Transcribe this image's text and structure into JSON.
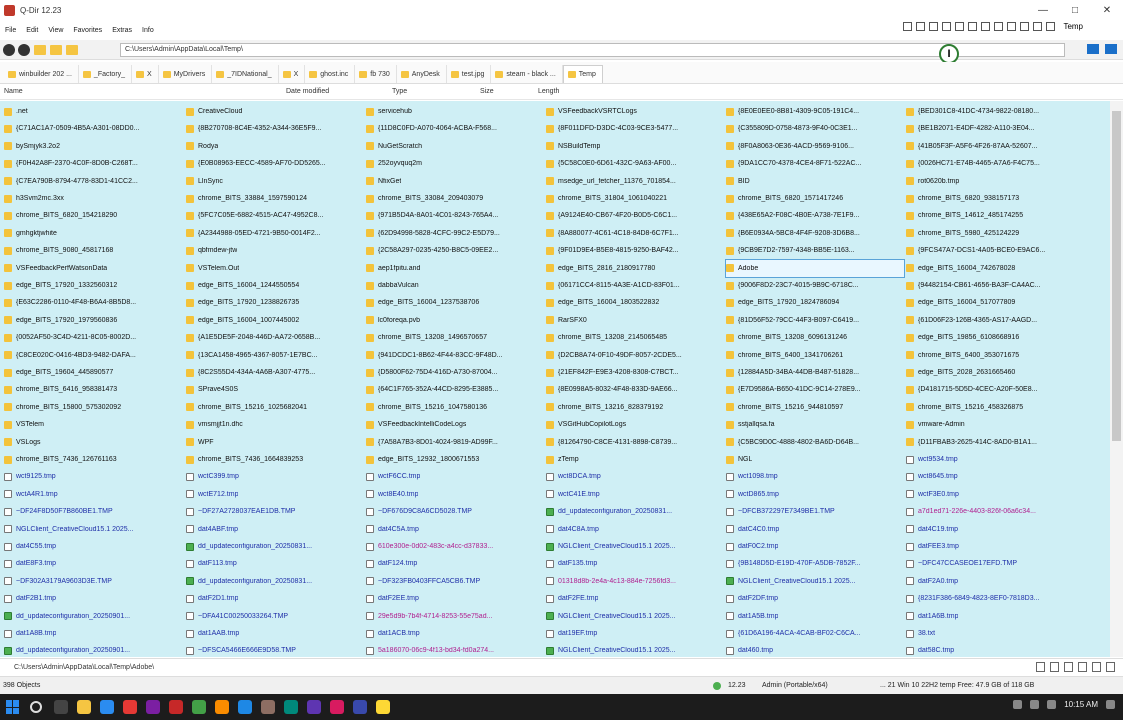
{
  "window": {
    "title": "Q-Dir 12.23",
    "controls": [
      "—",
      "□",
      "✕"
    ]
  },
  "menu": {
    "items": [
      "File",
      "Edit",
      "View",
      "Favorites",
      "Extras",
      "Info"
    ],
    "folder_label": "Temp"
  },
  "address": {
    "path": "C:\\Users\\Admin\\AppData\\Local\\Temp\\"
  },
  "tabs": [
    {
      "label": "winbuilder 202 ..."
    },
    {
      "label": "_Factory_"
    },
    {
      "label": "X"
    },
    {
      "label": "MyDrivers"
    },
    {
      "label": "_7IDNational_"
    },
    {
      "label": "X"
    },
    {
      "label": "ghost.inc"
    },
    {
      "label": "fb 730"
    },
    {
      "label": "AnyDesk"
    },
    {
      "label": "test.jpg"
    },
    {
      "label": "steam - black ..."
    },
    {
      "label": "Temp",
      "active": true
    }
  ],
  "columns": {
    "name": "Name",
    "date_modified": "Date modified",
    "type": "Type",
    "size": "Size",
    "length": "Length"
  },
  "files": [
    [
      {
        "n": ".net",
        "t": "folder"
      },
      {
        "n": "{C71AC1A7-0509-4B5A-A301-08DD0...",
        "t": "folder"
      },
      {
        "n": "bySmjyk3.2o2",
        "t": "folder"
      },
      {
        "n": "{F0H42A8F-2370-4C0F-8D0B-C268T...",
        "t": "folder"
      },
      {
        "n": "{C7EA790B-8794-4778-83D1-41CC2...",
        "t": "folder"
      },
      {
        "n": "h3Svm2mc.3xx",
        "t": "folder"
      },
      {
        "n": "chrome_BITS_6820_154218290",
        "t": "folder"
      },
      {
        "n": "gmhgktjwhite",
        "t": "folder"
      },
      {
        "n": "chrome_BITS_9080_45817168",
        "t": "folder"
      },
      {
        "n": "VSFeedbackPerfWatsonData",
        "t": "folder"
      },
      {
        "n": "edge_BITS_17920_1332560312",
        "t": "folder"
      },
      {
        "n": "{E63C2286-0110-4F48-B6A4-8B5D8...",
        "t": "folder"
      },
      {
        "n": "edge_BITS_17920_1979560836",
        "t": "folder"
      },
      {
        "n": "{0052AF50-3C4D-4211-8C05-8002D...",
        "t": "folder"
      },
      {
        "n": "{C8CE020C-0416-4BD3-9482-DAFA...",
        "t": "folder"
      },
      {
        "n": "edge_BITS_19604_445890577",
        "t": "folder"
      },
      {
        "n": "chrome_BITS_6416_958381473",
        "t": "folder"
      },
      {
        "n": "chrome_BITS_15800_575302092",
        "t": "folder"
      },
      {
        "n": "VSTelem",
        "t": "folder"
      },
      {
        "n": "VSLogs",
        "t": "folder"
      },
      {
        "n": "chrome_BITS_7436_126761163",
        "t": "folder"
      },
      {
        "n": "wct9125.tmp",
        "t": "file"
      },
      {
        "n": "wctA4R1.tmp",
        "t": "file"
      },
      {
        "n": "~DF24F8D50F7B860BE1.TMP",
        "t": "file"
      },
      {
        "n": "NGLClient_CreativeCloud15.1 2025...",
        "t": "file"
      },
      {
        "n": "dat4C55.tmp",
        "t": "file"
      },
      {
        "n": "datE8F3.tmp",
        "t": "file"
      },
      {
        "n": "~DF302A3179A9603D3E.TMP",
        "t": "file"
      },
      {
        "n": "datF2B1.tmp",
        "t": "file"
      },
      {
        "n": "dd_updateconfiguration_20250901...",
        "t": "green"
      },
      {
        "n": "dat1A8B.tmp",
        "t": "file"
      },
      {
        "n": "dd_updateconfiguration_20250901...",
        "t": "green"
      }
    ],
    [
      {
        "n": "CreativeCloud",
        "t": "folder"
      },
      {
        "n": "{8B270708-8C4E-4352-A344-36E5F9...",
        "t": "folder"
      },
      {
        "n": "Rodya",
        "t": "folder"
      },
      {
        "n": "{E0B08963-EECC-4589-AF70-DD5265...",
        "t": "folder"
      },
      {
        "n": "LlnSync",
        "t": "folder"
      },
      {
        "n": "chrome_BITS_33884_1597590124",
        "t": "folder"
      },
      {
        "n": "{5FC7C05E-6882-4515-AC47-4952C8...",
        "t": "folder"
      },
      {
        "n": "{A2344988-05ED-4721-9B50-0014F2...",
        "t": "folder"
      },
      {
        "n": "qbfmdew-jtw",
        "t": "folder"
      },
      {
        "n": "VSTelem.Out",
        "t": "folder"
      },
      {
        "n": "edge_BITS_16004_1244550554",
        "t": "folder"
      },
      {
        "n": "edge_BITS_17920_1238826735",
        "t": "folder"
      },
      {
        "n": "edge_BITS_16004_1007445002",
        "t": "folder"
      },
      {
        "n": "{A1E5DE5F-2048-446D-AA72-0658B...",
        "t": "folder"
      },
      {
        "n": "{13CA1458-4965-4367-8057-1E7BC...",
        "t": "folder"
      },
      {
        "n": "{8C2S55D4-434A-4A6B-A307-4775...",
        "t": "folder"
      },
      {
        "n": "SPrave4S0S",
        "t": "folder"
      },
      {
        "n": "chrome_BITS_15216_1025682041",
        "t": "folder"
      },
      {
        "n": "vmsmjjt1n.dhc",
        "t": "folder"
      },
      {
        "n": "WPF",
        "t": "folder"
      },
      {
        "n": "chrome_BITS_7436_1664839253",
        "t": "folder"
      },
      {
        "n": "wctC399.tmp",
        "t": "file"
      },
      {
        "n": "wctE712.tmp",
        "t": "file"
      },
      {
        "n": "~DF27A2728037EAE1DB.TMP",
        "t": "file"
      },
      {
        "n": "dat4ABF.tmp",
        "t": "file"
      },
      {
        "n": "dd_updateconfiguration_20250831...",
        "t": "green"
      },
      {
        "n": "datF113.tmp",
        "t": "file"
      },
      {
        "n": "dd_updateconfiguration_20250831...",
        "t": "green"
      },
      {
        "n": "datF2D1.tmp",
        "t": "file"
      },
      {
        "n": "~DFA41C00250033264.TMP",
        "t": "file"
      },
      {
        "n": "dat1AAB.tmp",
        "t": "file"
      },
      {
        "n": "~DFSCA5466E666E9D58.TMP",
        "t": "file"
      }
    ],
    [
      {
        "n": "servicehub",
        "t": "folder"
      },
      {
        "n": "{11D8C0FD-A070-4064-ACBA-F568...",
        "t": "folder"
      },
      {
        "n": "NuGetScratch",
        "t": "folder"
      },
      {
        "n": "252oyvquq2m",
        "t": "folder"
      },
      {
        "n": "NfixGet",
        "t": "folder"
      },
      {
        "n": "chrome_BITS_33084_209403079",
        "t": "folder"
      },
      {
        "n": "{971B5D4A-8A01-4C01-8243-765A4...",
        "t": "folder"
      },
      {
        "n": "{62D94998-5828-4CFC-99C2-E5D79...",
        "t": "folder"
      },
      {
        "n": "{2C58A297-0235-4250-B8C5-09EE2...",
        "t": "folder"
      },
      {
        "n": "aep1fpitu.and",
        "t": "folder"
      },
      {
        "n": "dabbaVulcan",
        "t": "folder"
      },
      {
        "n": "edge_BITS_16004_1237538706",
        "t": "folder"
      },
      {
        "n": "lc0foreqa.pvb",
        "t": "folder"
      },
      {
        "n": "chrome_BITS_13208_1496570657",
        "t": "folder"
      },
      {
        "n": "{941DCDC1-8B62-4F44-83CC-9F48D...",
        "t": "folder"
      },
      {
        "n": "{D5800F62-75D4-416D-A730-87004...",
        "t": "folder"
      },
      {
        "n": "{64C1F765-352A-44CD-8295-E3885...",
        "t": "folder"
      },
      {
        "n": "chrome_BITS_15216_1047580136",
        "t": "folder"
      },
      {
        "n": "VSFeedbackIntelliCodeLogs",
        "t": "folder"
      },
      {
        "n": "{7A58A7B3-8D01-4024-9819-AD99F...",
        "t": "folder"
      },
      {
        "n": "edge_BITS_12932_1800671553",
        "t": "folder"
      },
      {
        "n": "wctF6CC.tmp",
        "t": "file"
      },
      {
        "n": "wct8E40.tmp",
        "t": "file"
      },
      {
        "n": "~DF676D9C8A6CD5028.TMP",
        "t": "file"
      },
      {
        "n": "dat4C5A.tmp",
        "t": "file"
      },
      {
        "n": "610e300e-0d02-483c-a4cc-d37833...",
        "t": "pink"
      },
      {
        "n": "datF124.tmp",
        "t": "file"
      },
      {
        "n": "~DF323FB0403FFCA5CB6.TMP",
        "t": "file"
      },
      {
        "n": "datF2EE.tmp",
        "t": "file"
      },
      {
        "n": "29e5d9b-7b4f-4714-8253-55e75ad...",
        "t": "pink"
      },
      {
        "n": "dat1ACB.tmp",
        "t": "file"
      },
      {
        "n": "5a186070-06c9-4f13-bd34-fd0a274...",
        "t": "pink"
      }
    ],
    [
      {
        "n": "VSFeedbackVSRTCLogs",
        "t": "folder"
      },
      {
        "n": "{8F011DFD-D3DC-4C03-9CE3-5477...",
        "t": "folder"
      },
      {
        "n": "NSBuildTemp",
        "t": "folder"
      },
      {
        "n": "{5C58C0E0-6D61-432C-9A63-AF00...",
        "t": "folder"
      },
      {
        "n": "msedge_url_fetcher_11376_701854...",
        "t": "folder"
      },
      {
        "n": "chrome_BITS_31804_1061040221",
        "t": "folder"
      },
      {
        "n": "{A9124E40-CB67-4F20-B0D5-C6C1...",
        "t": "folder"
      },
      {
        "n": "{8A880077-4C61-4C18-84D8-6C7F1...",
        "t": "folder"
      },
      {
        "n": "{9F01D9E4-B5E8-4815-9250-BAF42...",
        "t": "folder"
      },
      {
        "n": "edge_BITS_2816_2180917780",
        "t": "folder"
      },
      {
        "n": "{06171CC4-8115-4A3E-A1CD-83F01...",
        "t": "folder"
      },
      {
        "n": "edge_BITS_16004_1803522832",
        "t": "folder"
      },
      {
        "n": "RarSFX0",
        "t": "folder"
      },
      {
        "n": "chrome_BITS_13208_2145065485",
        "t": "folder"
      },
      {
        "n": "{D2CB8A74-0F10-49DF-8057-2CDE5...",
        "t": "folder"
      },
      {
        "n": "{21EF842F-E9E3-4208-8308-C7BCT...",
        "t": "folder"
      },
      {
        "n": "{8E0998A5-8032-4F48-833D-9AE66...",
        "t": "folder"
      },
      {
        "n": "chrome_BITS_13216_828379192",
        "t": "folder"
      },
      {
        "n": "VSGitHubCopilotLogs",
        "t": "folder"
      },
      {
        "n": "{81264790-C8CE-4131-8898-C8739...",
        "t": "folder"
      },
      {
        "n": "zTemp",
        "t": "folder"
      },
      {
        "n": "wct8DCA.tmp",
        "t": "file"
      },
      {
        "n": "wctC41E.tmp",
        "t": "file"
      },
      {
        "n": "dd_updateconfiguration_20250831...",
        "t": "green"
      },
      {
        "n": "dat4C8A.tmp",
        "t": "file"
      },
      {
        "n": "NGLClient_CreativeCloud15.1 2025...",
        "t": "green"
      },
      {
        "n": "datF135.tmp",
        "t": "file"
      },
      {
        "n": "01318d8b-2e4a-4c13-884e-7256fd3...",
        "t": "pink"
      },
      {
        "n": "datF2FE.tmp",
        "t": "file"
      },
      {
        "n": "NGLClient_CreativeCloud15.1 2025...",
        "t": "green"
      },
      {
        "n": "dat19EF.tmp",
        "t": "file"
      },
      {
        "n": "NGLClient_CreativeCloud15.1 2025...",
        "t": "green"
      }
    ],
    [
      {
        "n": "{8E0E0EE0-8B81-4309-9C05-191C4...",
        "t": "folder"
      },
      {
        "n": "{C355809D-0758-4873-9F40-0C3E1...",
        "t": "folder"
      },
      {
        "n": "{8F0A8063-0E36-4ACD-9569-9106...",
        "t": "folder"
      },
      {
        "n": "{9DA1CC70-4378-4CE4-8F71-522AC...",
        "t": "folder"
      },
      {
        "n": "BID",
        "t": "folder"
      },
      {
        "n": "chrome_BITS_6820_1571417246",
        "t": "folder"
      },
      {
        "n": "{438E65A2-F08C-4B0E-A738-7E1F9...",
        "t": "folder"
      },
      {
        "n": "{B6E0934A-5BC8-4F4F-9208-3D6B8...",
        "t": "folder"
      },
      {
        "n": "{9CB9E7D2-7597-4348-BB5E-1163...",
        "t": "folder"
      },
      {
        "n": "Adobe",
        "t": "folder",
        "selected": true
      },
      {
        "n": "{9006F8D2-23C7-4015-9B9C-6718C...",
        "t": "folder"
      },
      {
        "n": "edge_BITS_17920_1824786094",
        "t": "folder"
      },
      {
        "n": "{81D56F52-79CC-44F3-B097-C6419...",
        "t": "folder"
      },
      {
        "n": "chrome_BITS_13208_6096131246",
        "t": "folder"
      },
      {
        "n": "chrome_BITS_6400_1341706261",
        "t": "folder"
      },
      {
        "n": "{12884A5D-34BA-44DB-B487-51828...",
        "t": "folder"
      },
      {
        "n": "{E7D9586A-B650-41DC-9C14-278E9...",
        "t": "folder"
      },
      {
        "n": "chrome_BITS_15216_944810597",
        "t": "folder"
      },
      {
        "n": "sstjallqsa.fa",
        "t": "folder"
      },
      {
        "n": "{C5BC9D0C-4888-4802-BA6D-D64B...",
        "t": "folder"
      },
      {
        "n": "NGL",
        "t": "folder"
      },
      {
        "n": "wct1098.tmp",
        "t": "file"
      },
      {
        "n": "wctD865.tmp",
        "t": "file"
      },
      {
        "n": "~DFCB372297E7349BE1.TMP",
        "t": "file"
      },
      {
        "n": "datC4C0.tmp",
        "t": "file"
      },
      {
        "n": "datF0C2.tmp",
        "t": "file"
      },
      {
        "n": "{9B148D5D-E19D-470F-A5DB-7852F...",
        "t": "file"
      },
      {
        "n": "NGLClient_CreativeCloud15.1 2025...",
        "t": "green"
      },
      {
        "n": "datF2DF.tmp",
        "t": "file"
      },
      {
        "n": "dat1A5B.tmp",
        "t": "file"
      },
      {
        "n": "{61D6A196-4ACA-4CAB-BF02-C6CA...",
        "t": "file"
      },
      {
        "n": "dat460.tmp",
        "t": "file"
      }
    ],
    [
      {
        "n": "{BED301C8-41DC-4734-9822-08180...",
        "t": "folder"
      },
      {
        "n": "{BE1B2071-E4DF-4282-A110-3E04...",
        "t": "folder"
      },
      {
        "n": "{41B05F3F-A5F6-4F26-87AA-52607...",
        "t": "folder"
      },
      {
        "n": "{0026HC71-E74B-4465-A7A6-F4C75...",
        "t": "folder"
      },
      {
        "n": "rot0620b.tmp",
        "t": "folder"
      },
      {
        "n": "chrome_BITS_6820_938157173",
        "t": "folder"
      },
      {
        "n": "chrome_BITS_14612_485174255",
        "t": "folder"
      },
      {
        "n": "chrome_BITS_5980_425124229",
        "t": "folder"
      },
      {
        "n": "{9FCS47A7-DCS1-4A05-BCE0-E9AC6...",
        "t": "folder"
      },
      {
        "n": "edge_BITS_16004_742678028",
        "t": "folder"
      },
      {
        "n": "{94482154-CB61-4656-BA3F-CA4AC...",
        "t": "folder"
      },
      {
        "n": "edge_BITS_16004_517077809",
        "t": "folder"
      },
      {
        "n": "{61D06F23-126B-4365-AS17-AAGD...",
        "t": "folder"
      },
      {
        "n": "edge_BITS_19856_6108668916",
        "t": "folder"
      },
      {
        "n": "chrome_BITS_6400_353071675",
        "t": "folder"
      },
      {
        "n": "edge_BITS_2028_2631665460",
        "t": "folder"
      },
      {
        "n": "{D4181715-5D5D-4CEC-A20F-50E8...",
        "t": "folder"
      },
      {
        "n": "chrome_BITS_15216_458326875",
        "t": "folder"
      },
      {
        "n": "vmware-Admin",
        "t": "folder"
      },
      {
        "n": "{D11FBAB3-2625-414C-8AD0-B1A1...",
        "t": "folder"
      },
      {
        "n": "wct9534.tmp",
        "t": "file"
      },
      {
        "n": "wct8645.tmp",
        "t": "file"
      },
      {
        "n": "wctF3E0.tmp",
        "t": "file"
      },
      {
        "n": "a7d1ed71-226e-4403-826f-06a6c34...",
        "t": "pink"
      },
      {
        "n": "dat4C19.tmp",
        "t": "file"
      },
      {
        "n": "datFEE3.tmp",
        "t": "file"
      },
      {
        "n": "~DFC47CCASEOE17EFD.TMP",
        "t": "file"
      },
      {
        "n": "datF2A0.tmp",
        "t": "file"
      },
      {
        "n": "{8231F386-6849-4823-8EF0-7818D3...",
        "t": "file"
      },
      {
        "n": "dat1A6B.tmp",
        "t": "file"
      },
      {
        "n": "38.txt",
        "t": "file"
      },
      {
        "n": "dat58C.tmp",
        "t": "file"
      }
    ]
  ],
  "pathbar": {
    "text": "C:\\Users\\Admin\\AppData\\Local\\Temp\\Adobe\\"
  },
  "status": {
    "objects": "398 Objects",
    "version": "12.23",
    "admin": "Admin (Portable/x64)",
    "info": "... 21 Win 10 22H2 temp Free: 47.9 GB of 118 GB"
  },
  "taskbar": {
    "clock": "10:15 AM"
  },
  "colors": {
    "list_bg": "#cfeff5",
    "folder": "#f3c33b",
    "file_text": "#1f2fa8",
    "pink_text": "#b0208f",
    "taskbar": "#1c1c1c"
  }
}
